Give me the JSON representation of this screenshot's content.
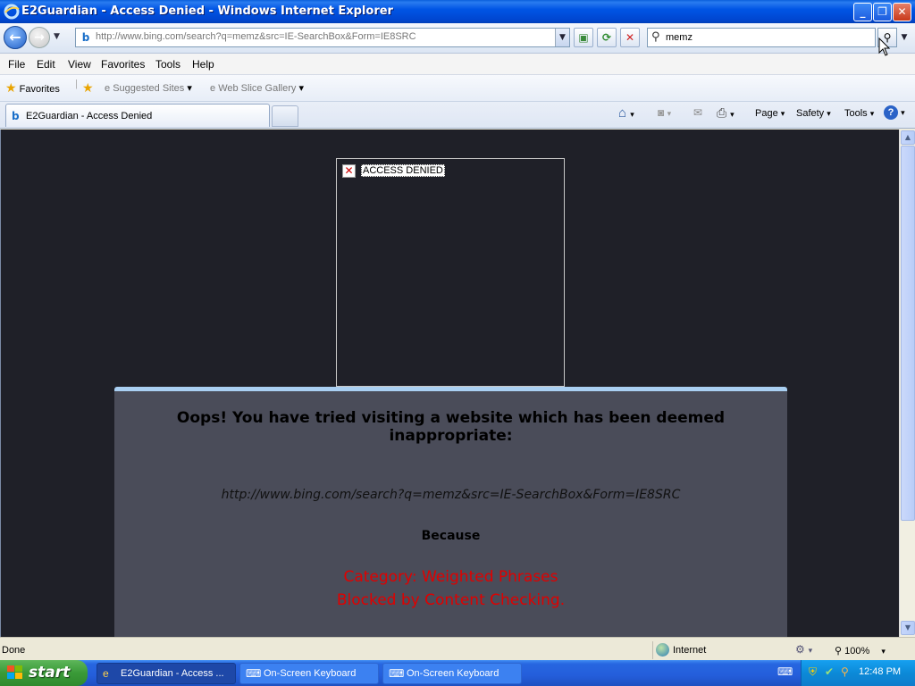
{
  "window": {
    "title": "E2Guardian - Access Denied - Windows Internet Explorer",
    "minimize_label": "_",
    "maximize_label": "❐",
    "close_label": "✕"
  },
  "navigation": {
    "address": "http://www.bing.com/search?q=memz&src=IE-SearchBox&Form=IE8SRC",
    "search_value": "memz"
  },
  "menu": {
    "items": [
      "File",
      "Edit",
      "View",
      "Favorites",
      "Tools",
      "Help"
    ]
  },
  "favorites_bar": {
    "favorites_label": "Favorites",
    "suggested_sites_label": "Suggested Sites",
    "web_slice_gallery_label": "Web Slice Gallery"
  },
  "tab": {
    "label": "E2Guardian - Access Denied"
  },
  "command_bar": {
    "page_label": "Page",
    "safety_label": "Safety",
    "tools_label": "Tools"
  },
  "content": {
    "image_alt": "ACCESS DENIED",
    "heading": "Oops! You have tried visiting a website which has been deemed inappropriate:",
    "blocked_url": "http://www.bing.com/search?q=memz&src=IE-SearchBox&Form=IE8SRC",
    "because_label": "Because",
    "reason_line1": "Category: Weighted Phrases",
    "reason_line2": "Blocked by Content Checking.",
    "reason_color": "#e00000"
  },
  "status_bar": {
    "status_text": "Done",
    "zone_text": "Internet",
    "zoom_text": "100%"
  },
  "taskbar": {
    "start_label": "start",
    "items": [
      {
        "label": "E2Guardian - Access ..."
      },
      {
        "label": "On-Screen Keyboard"
      },
      {
        "label": "On-Screen Keyboard"
      }
    ],
    "clock": "12:48 PM"
  },
  "icons": [
    "ie-logo-icon",
    "back-arrow-icon",
    "forward-arrow-icon",
    "compatibility-icon",
    "refresh-icon",
    "stop-icon",
    "search-icon",
    "favorites-star-icon",
    "add-favorites-icon",
    "home-icon",
    "feeds-icon",
    "mail-icon",
    "print-icon",
    "help-icon",
    "broken-image-icon",
    "globe-icon",
    "windows-flag-icon",
    "keyboard-icon",
    "shield-icon"
  ]
}
